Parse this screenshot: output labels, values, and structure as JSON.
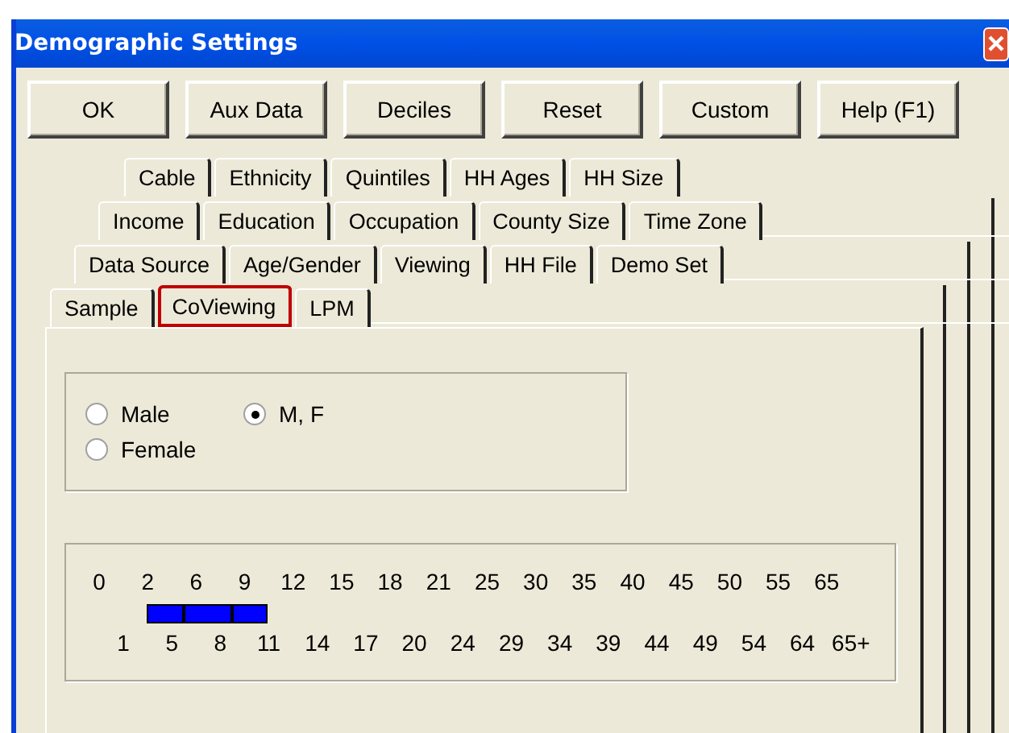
{
  "window": {
    "title": "Demographic Settings"
  },
  "buttons": [
    "OK",
    "Aux Data",
    "Deciles",
    "Reset",
    "Custom",
    "Help (F1)"
  ],
  "tab_rows": [
    [
      {
        "label": "Cable",
        "selected": false
      },
      {
        "label": "Ethnicity",
        "selected": false
      },
      {
        "label": "Quintiles",
        "selected": false
      },
      {
        "label": "HH Ages",
        "selected": false
      },
      {
        "label": "HH Size",
        "selected": false
      }
    ],
    [
      {
        "label": "Income",
        "selected": false
      },
      {
        "label": "Education",
        "selected": false
      },
      {
        "label": "Occupation",
        "selected": false
      },
      {
        "label": "County Size",
        "selected": false
      },
      {
        "label": "Time Zone",
        "selected": false
      }
    ],
    [
      {
        "label": "Data Source",
        "selected": false
      },
      {
        "label": "Age/Gender",
        "selected": false
      },
      {
        "label": "Viewing",
        "selected": false
      },
      {
        "label": "HH File",
        "selected": false
      },
      {
        "label": "Demo Set",
        "selected": false
      }
    ],
    [
      {
        "label": "Sample",
        "selected": false
      },
      {
        "label": "CoViewing",
        "selected": true
      },
      {
        "label": "LPM",
        "selected": false
      }
    ]
  ],
  "gender_options": [
    {
      "label": "Male",
      "selected": false
    },
    {
      "label": "M, F",
      "selected": true
    },
    {
      "label": "Female",
      "selected": false
    }
  ],
  "age_groups": [
    {
      "lo": "0",
      "hi": "1",
      "selected": false
    },
    {
      "lo": "2",
      "hi": "5",
      "selected": true
    },
    {
      "lo": "6",
      "hi": "8",
      "selected": true
    },
    {
      "lo": "9",
      "hi": "11",
      "selected": true
    },
    {
      "lo": "12",
      "hi": "14",
      "selected": false
    },
    {
      "lo": "15",
      "hi": "17",
      "selected": false
    },
    {
      "lo": "18",
      "hi": "20",
      "selected": false
    },
    {
      "lo": "21",
      "hi": "24",
      "selected": false
    },
    {
      "lo": "25",
      "hi": "29",
      "selected": false
    },
    {
      "lo": "30",
      "hi": "34",
      "selected": false
    },
    {
      "lo": "35",
      "hi": "39",
      "selected": false
    },
    {
      "lo": "40",
      "hi": "44",
      "selected": false
    },
    {
      "lo": "45",
      "hi": "49",
      "selected": false
    },
    {
      "lo": "50",
      "hi": "54",
      "selected": false
    },
    {
      "lo": "55",
      "hi": "64",
      "selected": false
    },
    {
      "lo": "65",
      "hi": "65+",
      "selected": false
    }
  ]
}
